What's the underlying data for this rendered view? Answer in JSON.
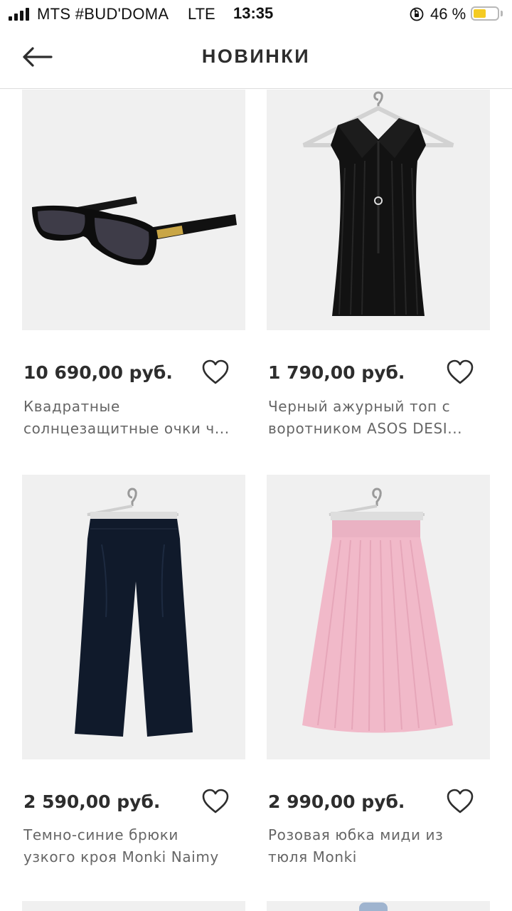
{
  "status_bar": {
    "carrier": "MTS #BUD'DOMA",
    "network": "LTE",
    "time": "13:35",
    "battery_percent": "46 %",
    "battery_level": 0.46,
    "battery_color": "#f4cb23"
  },
  "header": {
    "title": "НОВИНКИ",
    "back_icon": "arrow-left-icon"
  },
  "products": [
    {
      "price": "10 690,00 руб.",
      "name_line1": "Квадратные",
      "name_line2": "солнцезащитные очки ч...",
      "image": "black-square-sunglasses"
    },
    {
      "price": "1 790,00 руб.",
      "name_line1": "Черный ажурный топ с",
      "name_line2": "воротником ASOS DESI...",
      "image": "black-ribbed-collar-top"
    },
    {
      "price": "2 590,00 руб.",
      "name_line1": "Темно-синие брюки",
      "name_line2": "узкого кроя Monki Naimy",
      "image": "navy-trousers"
    },
    {
      "price": "2 990,00 руб.",
      "name_line1": "Розовая юбка миди из",
      "name_line2": "тюля Monki",
      "image": "pink-tulle-midi-skirt"
    }
  ],
  "colors": {
    "text_primary": "#2d2d2d",
    "text_secondary": "#666666",
    "image_bg": "#f0f0f0",
    "skirt_pink": "#f1b9c9",
    "trousers_navy": "#101a2b"
  }
}
